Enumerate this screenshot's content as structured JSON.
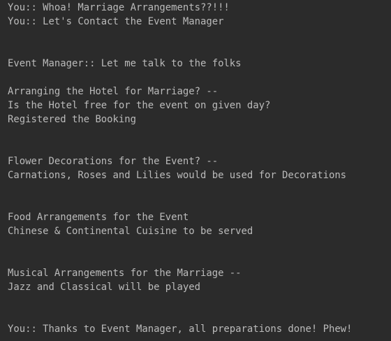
{
  "console": {
    "lines": [
      "You:: Whoa! Marriage Arrangements??!!!",
      "You:: Let's Contact the Event Manager",
      "",
      "",
      "Event Manager:: Let me talk to the folks",
      "",
      "Arranging the Hotel for Marriage? --",
      "Is the Hotel free for the event on given day?",
      "Registered the Booking",
      "",
      "",
      "Flower Decorations for the Event? --",
      "Carnations, Roses and Lilies would be used for Decorations",
      "",
      "",
      "Food Arrangements for the Event",
      "Chinese & Continental Cuisine to be served",
      "",
      "",
      "Musical Arrangements for the Marriage --",
      "Jazz and Classical will be played",
      "",
      "",
      "You:: Thanks to Event Manager, all preparations done! Phew!"
    ]
  },
  "colors": {
    "background": "#2b2b2b",
    "text": "#bbbbbb"
  }
}
